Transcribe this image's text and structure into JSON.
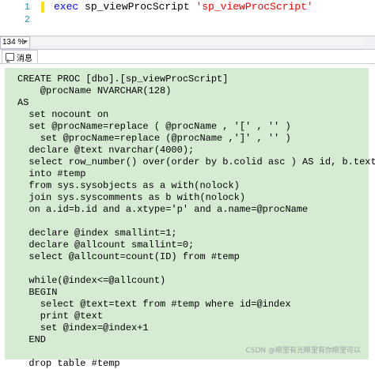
{
  "editor": {
    "lines": [
      {
        "number": "1",
        "keyword": "exec",
        "text": " sp_viewProcScript ",
        "string": "'sp_viewProcScript'"
      },
      {
        "number": "2",
        "keyword": "",
        "text": "",
        "string": ""
      }
    ]
  },
  "statusbar": {
    "zoom": "134 %"
  },
  "tabs": {
    "messages_label": "消息"
  },
  "messages": {
    "lines": [
      "CREATE PROC [dbo].[sp_viewProcScript]",
      "    @procName NVARCHAR(128)",
      "AS",
      "  set nocount on",
      "  set @procName=replace ( @procName , '[' , '' )",
      "    set @procName=replace (@procName ,']' , '' )",
      "  declare @text nvarchar(4000);",
      "  select row_number() over(order by b.colid asc ) AS id, b.text",
      "  into #temp",
      "  from sys.sysobjects as a with(nolock)",
      "  join sys.syscomments as b with(nolock)",
      "  on a.id=b.id and a.xtype='p' and a.name=@procName",
      "",
      "  declare @index smallint=1;",
      "  declare @allcount smallint=0;",
      "  select @allcount=count(ID) from #temp",
      "",
      "  while(@index<=@allcount)",
      "  BEGIN",
      "    select @text=text from #temp where id=@index",
      "    print @text",
      "    set @index=@index+1",
      "  END",
      "",
      "  drop table #temp"
    ],
    "watermark": "CSDN @眼里有光眼里有你眼里可以"
  }
}
